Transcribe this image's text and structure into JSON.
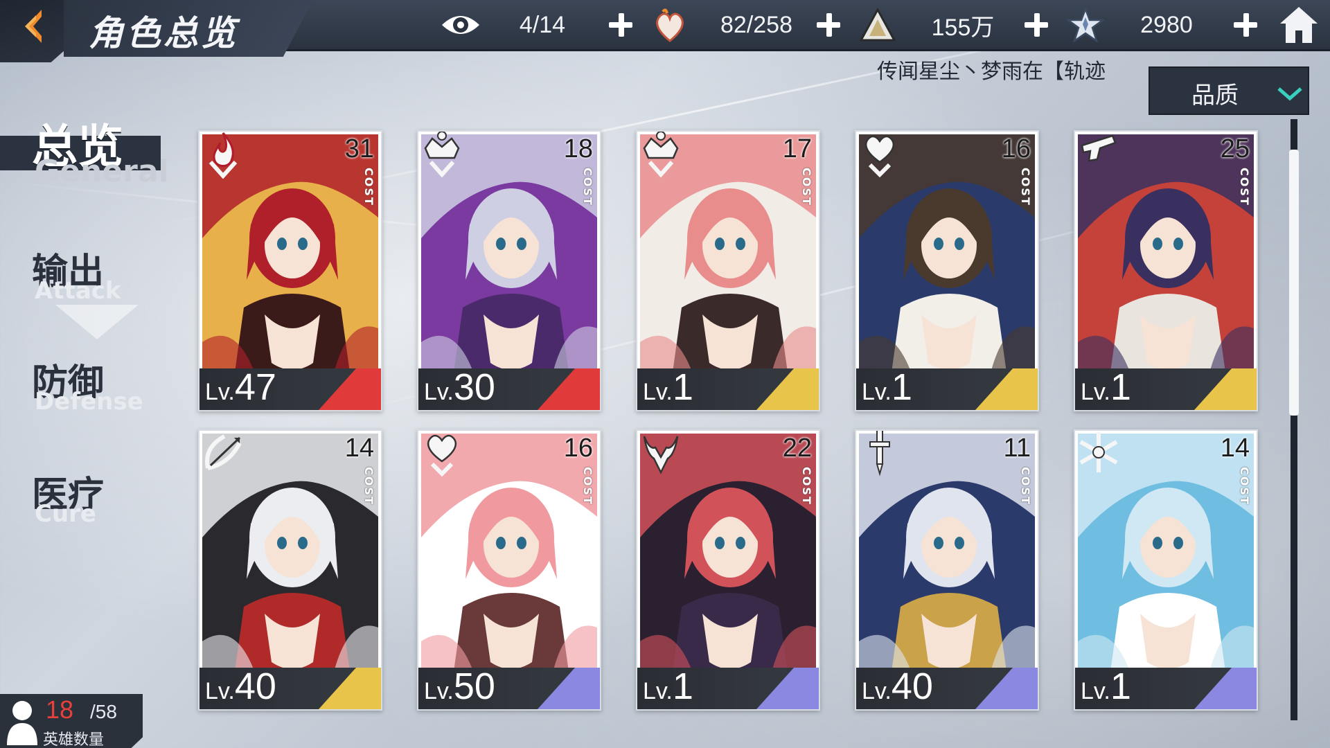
{
  "header": {
    "title": "角色总览",
    "resources": [
      {
        "icon": "eye-icon",
        "value": "4/14"
      },
      {
        "icon": "heart-fire-icon",
        "value": "82/258"
      },
      {
        "icon": "triangle-crystal-icon",
        "value": "155万"
      },
      {
        "icon": "star-crystal-icon",
        "value": "2980"
      }
    ]
  },
  "ticker": {
    "text": "传闻星尘丶梦雨在【轨迹"
  },
  "filter": {
    "label": "品质"
  },
  "categories": [
    {
      "zh": "总览",
      "en": "General"
    },
    {
      "zh": "输出",
      "en": "Attack"
    },
    {
      "zh": "防御",
      "en": "Defense"
    },
    {
      "zh": "医疗",
      "en": "Cure"
    }
  ],
  "cost_label": "COST",
  "lv_prefix": "Lv.",
  "cards": [
    {
      "emblem": "flame-emblem-icon",
      "cost": "31",
      "level": "47",
      "rarity_color": "#e03a3a",
      "palette": [
        "#b0202a",
        "#e8b04a",
        "#3b1a1a"
      ]
    },
    {
      "emblem": "crown-emblem-icon",
      "cost": "18",
      "level": "30",
      "rarity_color": "#e03a3a",
      "palette": [
        "#cfcfe3",
        "#7a3aa0",
        "#4a2a6a"
      ]
    },
    {
      "emblem": "crown-emblem-icon",
      "cost": "17",
      "level": "1",
      "rarity_color": "#e8c44a",
      "palette": [
        "#e98c8c",
        "#f1ece6",
        "#3a2a2a"
      ]
    },
    {
      "emblem": "heart-emblem-icon",
      "cost": "16",
      "level": "1",
      "rarity_color": "#e8c44a",
      "palette": [
        "#4a3a2e",
        "#2a3a6a",
        "#f2eee8"
      ]
    },
    {
      "emblem": "gun-emblem-icon",
      "cost": "25",
      "level": "1",
      "rarity_color": "#e8c44a",
      "palette": [
        "#3a3060",
        "#c4423a",
        "#e9e4de"
      ]
    },
    {
      "emblem": "bow-emblem-icon",
      "cost": "14",
      "level": "40",
      "rarity_color": "#e8c44a",
      "palette": [
        "#ecedf0",
        "#2a2a2e",
        "#b02a2a"
      ]
    },
    {
      "emblem": "heart-emblem-icon",
      "cost": "16",
      "level": "50",
      "rarity_color": "#8a88e0",
      "palette": [
        "#f09aa0",
        "#ffffff",
        "#6a3a3a"
      ]
    },
    {
      "emblem": "demon-emblem-icon",
      "cost": "22",
      "level": "1",
      "rarity_color": "#8a88e0",
      "palette": [
        "#d2525a",
        "#2a2030",
        "#3a2a4a"
      ]
    },
    {
      "emblem": "sword-emblem-icon",
      "cost": "11",
      "level": "40",
      "rarity_color": "#8a88e0",
      "palette": [
        "#dfe4ee",
        "#2a3a6a",
        "#c9a24a"
      ]
    },
    {
      "emblem": "snowflake-emblem-icon",
      "cost": "14",
      "level": "1",
      "rarity_color": "#8a88e0",
      "palette": [
        "#cfe8f4",
        "#6fbde0",
        "#ffffff"
      ]
    }
  ],
  "hero_count": {
    "current": "18",
    "max": "/58",
    "label": "英雄数量"
  },
  "colors": {
    "accent_orange": "#f08a2a",
    "header_dark": "#2b3340",
    "hero_count_red": "#e8403a"
  }
}
